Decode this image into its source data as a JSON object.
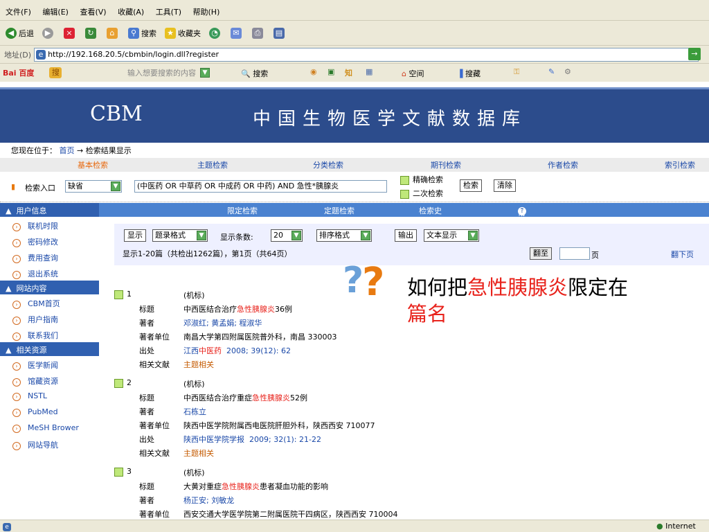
{
  "menubar": [
    "文件(F)",
    "编辑(E)",
    "查看(V)",
    "收藏(A)",
    "工具(T)",
    "帮助(H)"
  ],
  "toolbar": {
    "back": "后退",
    "search": "搜索",
    "favorites": "收藏夹"
  },
  "address": {
    "label": "地址(D)",
    "url": "http://192.168.20.5/cbmbin/login.dll?register"
  },
  "baidu": {
    "logo": "Bai 百度",
    "placeholder": "输入想要搜索的内容",
    "search": "搜索",
    "space": "空间",
    "favorites": "搜藏"
  },
  "site": {
    "logo": "CBM",
    "title": "中国生物医学文献数据库"
  },
  "breadcrumb": {
    "prefix": "您现在位于：",
    "home": "首页",
    "arrow": "→",
    "current": "检索结果显示"
  },
  "tabs": [
    "基本检索",
    "主题检索",
    "分类检索",
    "期刊检索",
    "作者检索",
    "索引检索"
  ],
  "search": {
    "entry_label": "检索入口",
    "entry_value": "缺省",
    "query": "(中医药 OR 中草药 OR 中成药 OR 中药) AND 急性*胰腺炎",
    "exact": "精确检索",
    "secondary": "二次检索",
    "search_btn": "检索",
    "clear_btn": "清除"
  },
  "sidebar": {
    "sections": [
      {
        "title": "用户信息",
        "items": [
          "联机时限",
          "密码修改",
          "费用查询",
          "退出系统"
        ]
      },
      {
        "title": "网站内容",
        "items": [
          "CBM首页",
          "用户指南",
          "联系我们"
        ]
      },
      {
        "title": "相关资源",
        "items": [
          "医学新闻",
          "馆藏资源",
          "NSTL",
          "PubMed",
          "MeSH Brower",
          "网站导航"
        ]
      }
    ]
  },
  "subnav": [
    "限定检索",
    "定题检索",
    "检索史",
    "帮助"
  ],
  "controls": {
    "display_btn": "显示",
    "format": "题录格式",
    "count_label": "显示条数:",
    "count": "20",
    "sort": "排序格式",
    "output_btn": "输出",
    "text_display": "文本显示",
    "summary": "显示1-20篇（共检出1262篇），第1页（共64页）",
    "goto_btn": "翻至",
    "page_label": "页",
    "next_page": "翻下页"
  },
  "callout": {
    "part1": "如何把",
    "part2": "急性胰腺炎",
    "part3": "限定在",
    "part4": "篇名"
  },
  "records": [
    {
      "num": "1",
      "type": "(机标)",
      "labels": [
        "标题",
        "著者",
        "著者单位",
        "出处",
        "相关文献"
      ],
      "title_pre": "中西医结合治疗",
      "title_hl": "急性胰腺炎",
      "title_post": "36例",
      "authors": "邓淑红; 黄孟娟; 程淑华",
      "affiliation": "南昌大学第四附属医院普外科，南昌 330003",
      "source_pre": "江西",
      "source_hl": "中医药",
      "source_post": "2008; 39(12): 62",
      "related": "主题相关"
    },
    {
      "num": "2",
      "type": "(机标)",
      "labels": [
        "标题",
        "著者",
        "著者单位",
        "出处",
        "相关文献"
      ],
      "title_pre": "中西医结合治疗重症",
      "title_hl": "急性胰腺炎",
      "title_post": "52例",
      "authors": "石栋立",
      "affiliation": "陕西中医学院附属西电医院肝胆外科，陕西西安 710077",
      "source_pre": "陕西中医学院学报",
      "source_hl": "",
      "source_post": "2009; 32(1): 21-22",
      "related": "主题相关"
    },
    {
      "num": "3",
      "type": "(机标)",
      "labels": [
        "标题",
        "著者",
        "著者单位"
      ],
      "title_pre": "大黄对重症",
      "title_hl": "急性胰腺炎",
      "title_post": "患者凝血功能的影响",
      "authors": "杨正安; 刘敏龙",
      "affiliation": "西安交通大学医学院第二附属医院干四病区，陕西西安 710004"
    }
  ],
  "status": "Internet"
}
